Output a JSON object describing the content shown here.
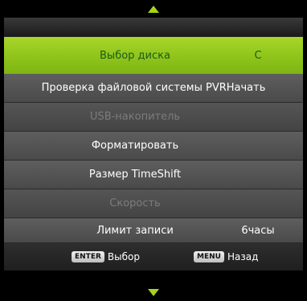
{
  "menu": {
    "items": [
      {
        "label": "Выбор диска",
        "value": "C",
        "state": "selected"
      },
      {
        "label": "Проверка файловой системы PVR",
        "value": "Начать",
        "state": "normal"
      },
      {
        "label": "USB-накопитель",
        "value": "",
        "state": "disabled"
      },
      {
        "label": "Форматировать",
        "value": "",
        "state": "normal"
      },
      {
        "label": "Размер TimeShift",
        "value": "",
        "state": "normal"
      },
      {
        "label": "Скорость",
        "value": "",
        "state": "disabled"
      },
      {
        "label": "Лимит записи",
        "value": "6часы",
        "state": "normal"
      }
    ]
  },
  "footer": {
    "hint1_key": "ENTER",
    "hint1_label": "Выбор",
    "hint2_key": "MENU",
    "hint2_label": "Назад"
  },
  "colors": {
    "accent": "#a5d21c",
    "selected_text": "#1a5a1a",
    "disabled_text": "#7c7c7c"
  },
  "icons": {
    "up": "arrow-up-triangle",
    "down": "arrow-down-triangle"
  }
}
